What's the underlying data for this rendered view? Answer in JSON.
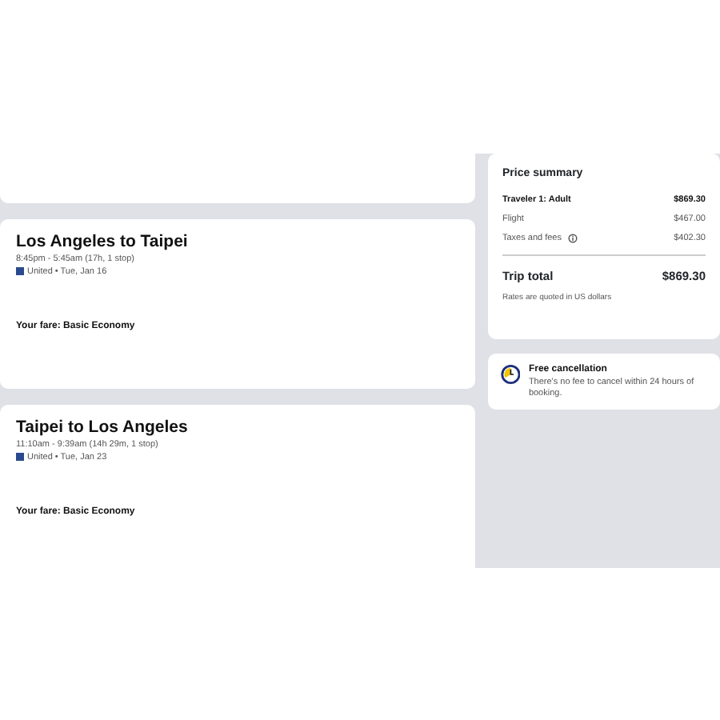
{
  "flights": [
    {
      "title": "Los Angeles to Taipei",
      "times": "8:45pm - 5:45am (17h, 1 stop)",
      "carrier": "United • Tue, Jan 16",
      "fare": "Your fare: Basic Economy"
    },
    {
      "title": "Taipei to Los Angeles",
      "times": "11:10am - 9:39am (14h 29m, 1 stop)",
      "carrier": "United • Tue, Jan 23",
      "fare": "Your fare: Basic Economy"
    }
  ],
  "price_summary": {
    "title": "Price summary",
    "lines": [
      {
        "kind": "head",
        "label": "Traveler 1: Adult",
        "amount": "$869.30"
      },
      {
        "kind": "line",
        "label": "Flight",
        "amount": "$467.00"
      },
      {
        "kind": "info",
        "label": "Taxes and fees",
        "amount": "$402.30"
      }
    ],
    "total_label": "Trip total",
    "total": "$869.30",
    "note": "Rates are quoted in US dollars"
  },
  "cancellation": {
    "title": "Free cancellation",
    "text": "There's no fee to cancel within 24 hours of booking."
  }
}
